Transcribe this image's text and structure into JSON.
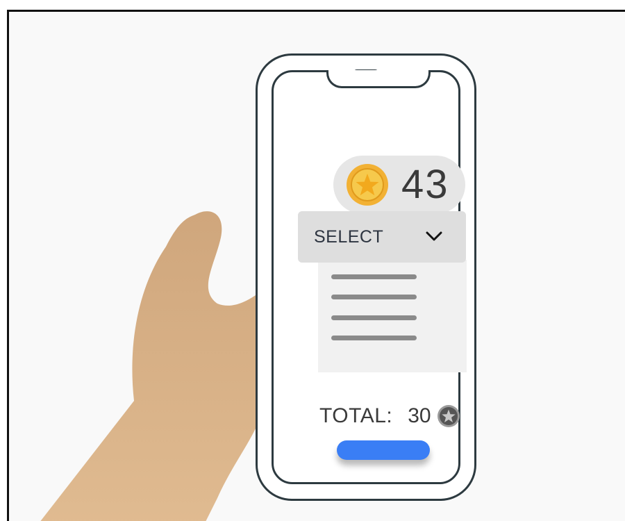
{
  "colors": {
    "skin": "#dab485",
    "phone_outline": "#2d3a40",
    "coin_gold": "#f2b134",
    "accent_blue": "#3a7ef5"
  },
  "wallet": {
    "balance": "43",
    "icon": "gold-star-coin-icon"
  },
  "dropdown": {
    "label": "SELECT",
    "icon": "chevron-down-icon",
    "expanded": true
  },
  "order": {
    "total_label": "TOTAL:",
    "total_value": "30",
    "icon": "grey-star-coin-icon"
  },
  "confirm_button": {
    "label": ""
  }
}
